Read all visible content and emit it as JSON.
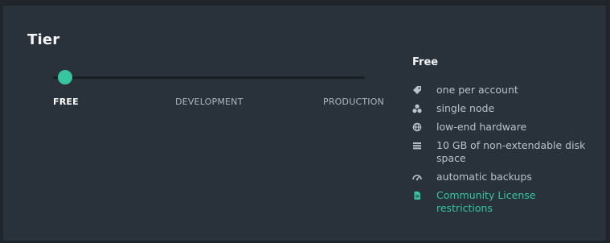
{
  "panel": {
    "title": "Tier"
  },
  "slider": {
    "value": 0,
    "stops": [
      "FREE",
      "DEVELOPMENT",
      "PRODUCTION"
    ],
    "selected": "FREE"
  },
  "details": {
    "title": "Free",
    "features": [
      {
        "icon": "tag-icon",
        "text": "one per account"
      },
      {
        "icon": "nodes-icon",
        "text": "single node"
      },
      {
        "icon": "globe-icon",
        "text": "low-end hardware"
      },
      {
        "icon": "storage-icon",
        "text": "10 GB of non-extendable disk space"
      },
      {
        "icon": "backup-gauge-icon",
        "text": "automatic backups"
      },
      {
        "icon": "document-icon",
        "text": "Community License restrictions"
      }
    ]
  },
  "colors": {
    "accent": "#35c6a0",
    "panel_bg": "#29313a",
    "page_bg": "#1f252b"
  }
}
